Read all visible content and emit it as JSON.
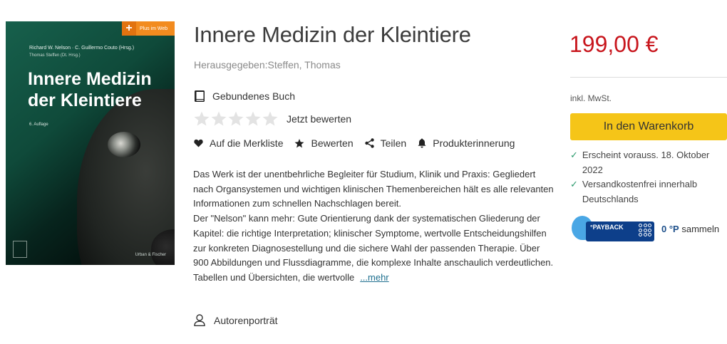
{
  "cover": {
    "badge_text": "Plus im Web",
    "authors": "Richard W. Nelson · C. Guillermo Couto (Hrsg.)",
    "editor": "Thomas Steffen (Dt. Hrsg.)",
    "title_line1": "Innere Medizin",
    "title_line2": "der Kleintiere",
    "edition": "6. Auflage",
    "publisher": "Urban & Fischer"
  },
  "product": {
    "title": "Innere Medizin der Kleintiere",
    "editor_line": "Herausgegeben:Steffen, Thomas",
    "format": "Gebundenes Buch",
    "rating_stars": 0,
    "rating_max": 5,
    "rate_label": "Jetzt bewerten"
  },
  "actions": {
    "wishlist": "Auf die Merkliste",
    "rate": "Bewerten",
    "share": "Teilen",
    "reminder": "Produkterinnerung"
  },
  "description": {
    "text": "Das Werk ist der unentbehrliche Begleiter für Studium, Klinik und Praxis: Gegliedert nach Organsystemen und wichtigen klinischen Themenbereichen hält es alle relevanten Informationen zum schnellen Nachschlagen bereit.\nDer \"Nelson\" kann mehr: Gute Orientierung dank der systematischen Gliederung der Kapitel: die richtige Interpretation; klinischer Symptome, wertvolle Entscheidungshilfen zur konkreten Diagnosestellung und die sichere Wahl der passenden Therapie. Über 900 Abbildungen und Flussdiagramme, die komplexe Inhalte anschaulich verdeutlichen. Tabellen und Übersichten, die wertvolle",
    "more_label": "...mehr"
  },
  "author_portrait": "Autorenporträt",
  "buy": {
    "price": "199,00 €",
    "vat": "inkl. MwSt.",
    "cart_button": "In den Warenkorb",
    "availability": "Erscheint vorauss. 18. Oktober 2022",
    "shipping": "Versandkostenfrei innerhalb Deutschlands",
    "payback_logo": "°PAYBACK",
    "payback_points": "0 °P",
    "payback_suffix": "sammeln"
  },
  "colors": {
    "price": "#c8161d",
    "cart_button": "#f5c518",
    "check": "#2a9a6c",
    "payback": "#0d3f8a"
  }
}
